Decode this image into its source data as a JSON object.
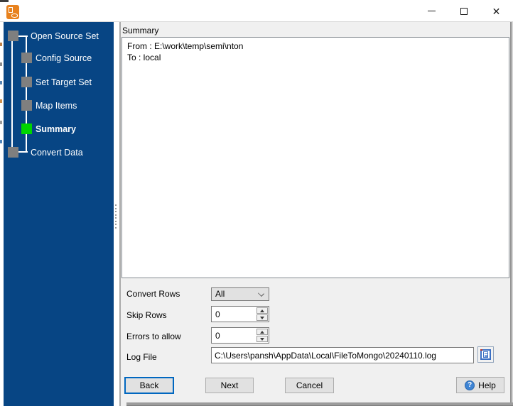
{
  "titlebar": {
    "icons": {
      "close": "✕"
    }
  },
  "sidebar": {
    "steps": [
      {
        "label": "Open Source Set",
        "state": "completed"
      },
      {
        "label": "Config Source",
        "state": "completed"
      },
      {
        "label": "Set Target Set",
        "state": "completed"
      },
      {
        "label": "Map Items",
        "state": "completed"
      },
      {
        "label": "Summary",
        "state": "current"
      },
      {
        "label": "Convert Data",
        "state": "pending"
      }
    ]
  },
  "main": {
    "panel_title": "Summary",
    "summary": {
      "lines": [
        "From : E:\\work\\temp\\semi\\nton",
        "To : local"
      ]
    },
    "form": {
      "convert_rows": {
        "label": "Convert Rows",
        "value": "All"
      },
      "skip_rows": {
        "label": "Skip Rows",
        "value": "0"
      },
      "errors_to_allow": {
        "label": "Errors to allow",
        "value": "0"
      },
      "log_file": {
        "label": "Log File",
        "value": "C:\\Users\\pansh\\AppData\\Local\\FileToMongo\\20240110.log"
      }
    },
    "buttons": {
      "back": "Back",
      "next": "Next",
      "cancel": "Cancel",
      "help": "Help",
      "help_icon": "?"
    }
  },
  "colors": {
    "sidebar_blue": "#074584",
    "active_step_green": "#00D500",
    "step_marker_gray": "#7F7F7F",
    "focus_border_blue": "#0067C0",
    "help_icon_blue": "#3E84D4",
    "app_icon_orange": "#E8821E"
  }
}
